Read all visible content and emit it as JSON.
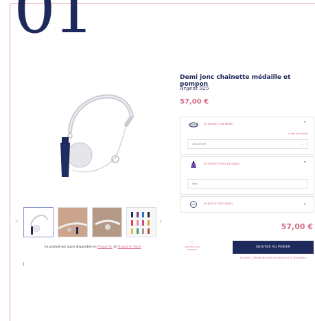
{
  "header": {
    "number": "01"
  },
  "product": {
    "title": "Demi jonc chaînette médaille et pompon",
    "material": "Argent 925",
    "price": "57,00 €"
  },
  "gallery": {
    "prev_arrow": "‹",
    "next_arrow": "›",
    "availability": {
      "prefix": "Ce produit est aussi disponible en ",
      "link1": "Plaqué Or",
      "middle": " et ",
      "link2": "Plaqué Or Rose"
    }
  },
  "options": [
    {
      "label": "Je choisis ma taille",
      "guide": "Guide des tailles",
      "value": "14 à 15 cm",
      "icon": "bracelet-size-icon",
      "expanded": true
    },
    {
      "label": "Je choisis mon pompon",
      "value": "Gris",
      "icon": "tassel-icon",
      "expanded": true
    },
    {
      "label": "Je grave mon bijou",
      "icon": "engrave-icon",
      "expanded": false
    }
  ],
  "purchase": {
    "price": "57,00 €",
    "wishlist_label": "AJOUTER À MA WISHLIST",
    "cart_button": "AJOUTER AU PANIER",
    "stock_note": "En stock - Départ de votre commande le 14 Novembre"
  },
  "colors": {
    "navy": "#1f2a5c",
    "pink": "#d86a86",
    "border": "#e3e3e3"
  }
}
